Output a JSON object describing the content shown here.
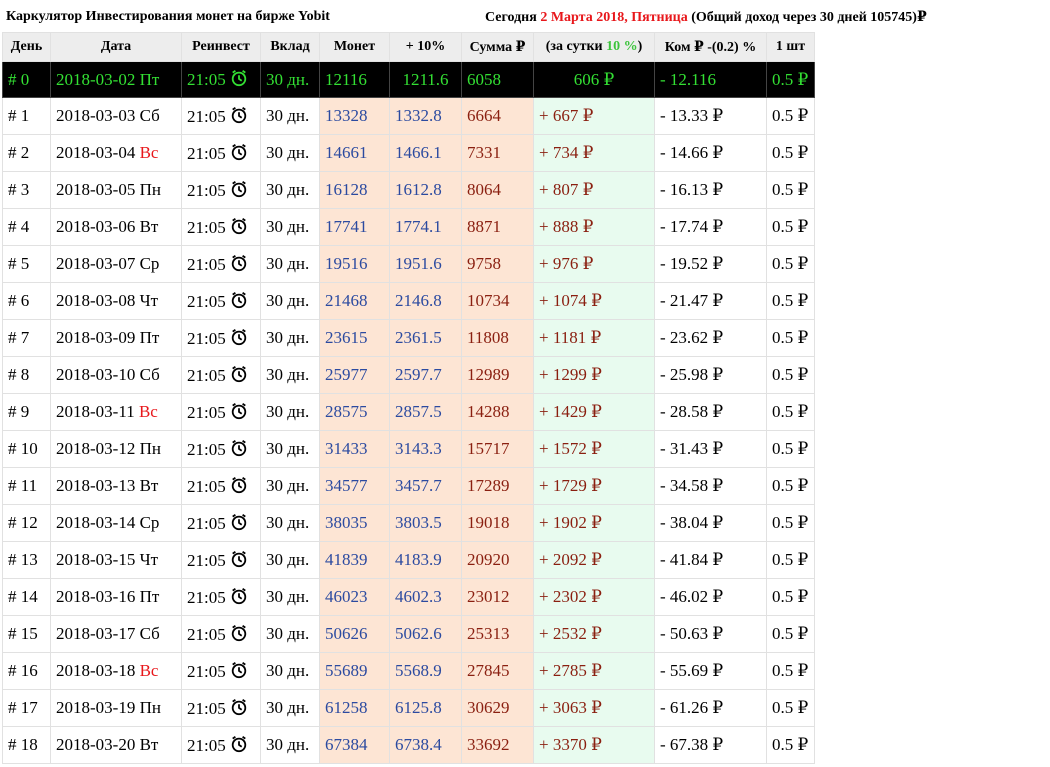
{
  "header": {
    "title": "Каркулятор Инвестирования монет на бирже Yobit",
    "today_label": "Сегодня",
    "today_date": "2 Марта 2018, Пятница",
    "total_text": "(Общий доход через 30 дней 105745)₽"
  },
  "columns": [
    "День",
    "Дата",
    "Реинвест",
    "Вклад",
    "Монет",
    "+ 10%",
    "Сумма ₽",
    "(за сутки 10 %)",
    "Ком ₽ -(0.2) %",
    "1 шт"
  ],
  "current_row": {
    "day": "# 0",
    "date": "2018-03-02 Пт",
    "time": "21:05",
    "deposit": "30 дн.",
    "coins": "12116",
    "plus10": "1211.6",
    "sum": "6058",
    "daily": "606 ₽",
    "fee": "- 12.116",
    "unit": "0.5 ₽"
  },
  "rows": [
    {
      "day": "# 1",
      "date": "2018-03-03",
      "wd": "Сб",
      "time": "21:05",
      "deposit": "30 дн.",
      "coins": "13328",
      "plus10": "1332.8",
      "sum": "6664",
      "daily": "+ 667 ₽",
      "fee": "- 13.33 ₽",
      "unit": "0.5 ₽"
    },
    {
      "day": "# 2",
      "date": "2018-03-04",
      "wd": "Вс",
      "time": "21:05",
      "deposit": "30 дн.",
      "coins": "14661",
      "plus10": "1466.1",
      "sum": "7331",
      "daily": "+ 734 ₽",
      "fee": "- 14.66 ₽",
      "unit": "0.5 ₽"
    },
    {
      "day": "# 3",
      "date": "2018-03-05",
      "wd": "Пн",
      "time": "21:05",
      "deposit": "30 дн.",
      "coins": "16128",
      "plus10": "1612.8",
      "sum": "8064",
      "daily": "+ 807 ₽",
      "fee": "- 16.13 ₽",
      "unit": "0.5 ₽"
    },
    {
      "day": "# 4",
      "date": "2018-03-06",
      "wd": "Вт",
      "time": "21:05",
      "deposit": "30 дн.",
      "coins": "17741",
      "plus10": "1774.1",
      "sum": "8871",
      "daily": "+ 888 ₽",
      "fee": "- 17.74 ₽",
      "unit": "0.5 ₽"
    },
    {
      "day": "# 5",
      "date": "2018-03-07",
      "wd": "Ср",
      "time": "21:05",
      "deposit": "30 дн.",
      "coins": "19516",
      "plus10": "1951.6",
      "sum": "9758",
      "daily": "+ 976 ₽",
      "fee": "- 19.52 ₽",
      "unit": "0.5 ₽"
    },
    {
      "day": "# 6",
      "date": "2018-03-08",
      "wd": "Чт",
      "time": "21:05",
      "deposit": "30 дн.",
      "coins": "21468",
      "plus10": "2146.8",
      "sum": "10734",
      "daily": "+ 1074 ₽",
      "fee": "- 21.47 ₽",
      "unit": "0.5 ₽"
    },
    {
      "day": "# 7",
      "date": "2018-03-09",
      "wd": "Пт",
      "time": "21:05",
      "deposit": "30 дн.",
      "coins": "23615",
      "plus10": "2361.5",
      "sum": "11808",
      "daily": "+ 1181 ₽",
      "fee": "- 23.62 ₽",
      "unit": "0.5 ₽"
    },
    {
      "day": "# 8",
      "date": "2018-03-10",
      "wd": "Сб",
      "time": "21:05",
      "deposit": "30 дн.",
      "coins": "25977",
      "plus10": "2597.7",
      "sum": "12989",
      "daily": "+ 1299 ₽",
      "fee": "- 25.98 ₽",
      "unit": "0.5 ₽"
    },
    {
      "day": "# 9",
      "date": "2018-03-11",
      "wd": "Вс",
      "time": "21:05",
      "deposit": "30 дн.",
      "coins": "28575",
      "plus10": "2857.5",
      "sum": "14288",
      "daily": "+ 1429 ₽",
      "fee": "- 28.58 ₽",
      "unit": "0.5 ₽"
    },
    {
      "day": "# 10",
      "date": "2018-03-12",
      "wd": "Пн",
      "time": "21:05",
      "deposit": "30 дн.",
      "coins": "31433",
      "plus10": "3143.3",
      "sum": "15717",
      "daily": "+ 1572 ₽",
      "fee": "- 31.43 ₽",
      "unit": "0.5 ₽"
    },
    {
      "day": "# 11",
      "date": "2018-03-13",
      "wd": "Вт",
      "time": "21:05",
      "deposit": "30 дн.",
      "coins": "34577",
      "plus10": "3457.7",
      "sum": "17289",
      "daily": "+ 1729 ₽",
      "fee": "- 34.58 ₽",
      "unit": "0.5 ₽"
    },
    {
      "day": "# 12",
      "date": "2018-03-14",
      "wd": "Ср",
      "time": "21:05",
      "deposit": "30 дн.",
      "coins": "38035",
      "plus10": "3803.5",
      "sum": "19018",
      "daily": "+ 1902 ₽",
      "fee": "- 38.04 ₽",
      "unit": "0.5 ₽"
    },
    {
      "day": "# 13",
      "date": "2018-03-15",
      "wd": "Чт",
      "time": "21:05",
      "deposit": "30 дн.",
      "coins": "41839",
      "plus10": "4183.9",
      "sum": "20920",
      "daily": "+ 2092 ₽",
      "fee": "- 41.84 ₽",
      "unit": "0.5 ₽"
    },
    {
      "day": "# 14",
      "date": "2018-03-16",
      "wd": "Пт",
      "time": "21:05",
      "deposit": "30 дн.",
      "coins": "46023",
      "plus10": "4602.3",
      "sum": "23012",
      "daily": "+ 2302 ₽",
      "fee": "- 46.02 ₽",
      "unit": "0.5 ₽"
    },
    {
      "day": "# 15",
      "date": "2018-03-17",
      "wd": "Сб",
      "time": "21:05",
      "deposit": "30 дн.",
      "coins": "50626",
      "plus10": "5062.6",
      "sum": "25313",
      "daily": "+ 2532 ₽",
      "fee": "- 50.63 ₽",
      "unit": "0.5 ₽"
    },
    {
      "day": "# 16",
      "date": "2018-03-18",
      "wd": "Вс",
      "time": "21:05",
      "deposit": "30 дн.",
      "coins": "55689",
      "plus10": "5568.9",
      "sum": "27845",
      "daily": "+ 2785 ₽",
      "fee": "- 55.69 ₽",
      "unit": "0.5 ₽"
    },
    {
      "day": "# 17",
      "date": "2018-03-19",
      "wd": "Пн",
      "time": "21:05",
      "deposit": "30 дн.",
      "coins": "61258",
      "plus10": "6125.8",
      "sum": "30629",
      "daily": "+ 3063 ₽",
      "fee": "- 61.26 ₽",
      "unit": "0.5 ₽"
    },
    {
      "day": "# 18",
      "date": "2018-03-20",
      "wd": "Вт",
      "time": "21:05",
      "deposit": "30 дн.",
      "coins": "67384",
      "plus10": "6738.4",
      "sum": "33692",
      "daily": "+ 3370 ₽",
      "fee": "- 67.38 ₽",
      "unit": "0.5 ₽"
    }
  ],
  "colors": {
    "accent_red": "#e8171b",
    "accent_green": "#3cc43c",
    "coins_bg": "#fde5d4",
    "daily_bg": "#e8fbef"
  },
  "icons": {
    "reinvest": "alarm-clock-icon"
  }
}
